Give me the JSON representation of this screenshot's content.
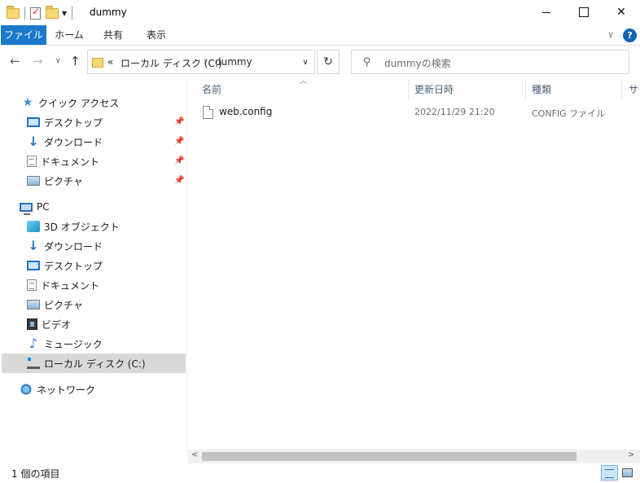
{
  "window": {
    "title": "dummy"
  },
  "ribbon": {
    "tabs": [
      "ファイル",
      "ホーム",
      "共有",
      "表示"
    ],
    "help": "?"
  },
  "address": {
    "overflow": "«",
    "crumbs": [
      "ローカル ディスク (C:)",
      "dummy"
    ]
  },
  "search": {
    "placeholder": "dummyの検索"
  },
  "navpane": {
    "quick_access": "クイック アクセス",
    "quick_items": [
      "デスクトップ",
      "ダウンロード",
      "ドキュメント",
      "ピクチャ"
    ],
    "pc": "PC",
    "pc_items": [
      "3D オブジェクト",
      "ダウンロード",
      "デスクトップ",
      "ドキュメント",
      "ピクチャ",
      "ビデオ",
      "ミュージック",
      "ローカル ディスク (C:)"
    ],
    "network": "ネットワーク"
  },
  "columns": {
    "name": "名前",
    "date": "更新日時",
    "type": "種類",
    "size": "サ"
  },
  "files": [
    {
      "name": "web.config",
      "date": "2022/11/29 21:20",
      "type": "CONFIG ファイル"
    }
  ],
  "status": {
    "count": "1 個の項目"
  }
}
